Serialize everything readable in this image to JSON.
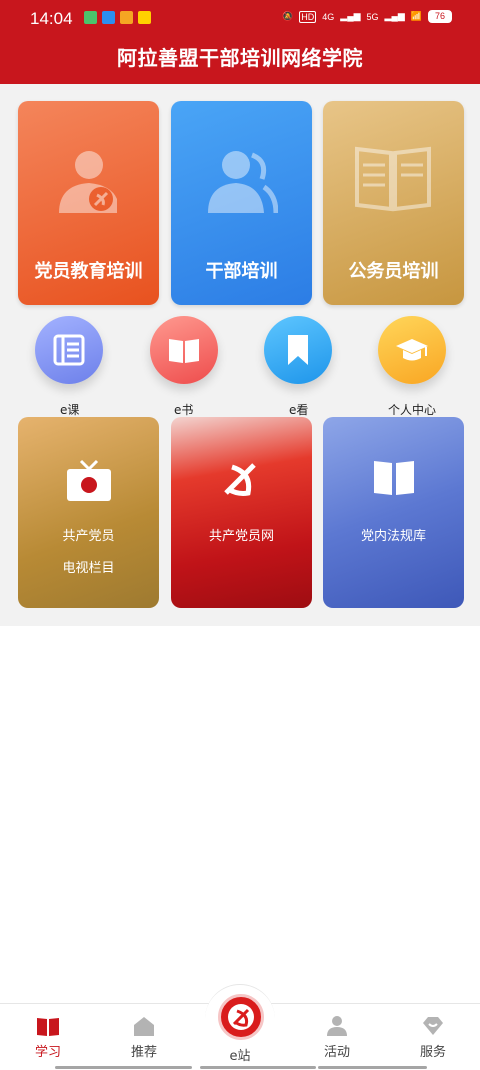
{
  "status_bar": {
    "time": "14:04",
    "battery": "76",
    "net1": "HD",
    "net2": "4G",
    "net3": "5G"
  },
  "header": {
    "title": "阿拉善盟干部培训网络学院"
  },
  "cards": [
    {
      "label": "党员教育培训",
      "icon": "party-member-icon"
    },
    {
      "label": "干部培训",
      "icon": "cadre-icon"
    },
    {
      "label": "公务员培训",
      "icon": "book-icon"
    }
  ],
  "quick_links": [
    {
      "label": "e课",
      "icon": "list-icon"
    },
    {
      "label": "e书",
      "icon": "book-icon"
    },
    {
      "label": "e看",
      "icon": "bookmark-icon"
    },
    {
      "label": "个人中心",
      "icon": "graduation-cap-icon"
    }
  ],
  "tiles": [
    {
      "line1": "共产党员",
      "line2": "电视栏目",
      "icon": "tv-icon"
    },
    {
      "label": "共产党员网",
      "icon": "party-emblem-icon"
    },
    {
      "label": "党内法规库",
      "icon": "open-book-icon"
    }
  ],
  "tabbar": {
    "items": [
      {
        "label": "学习",
        "icon": "book-icon",
        "active": true
      },
      {
        "label": "推荐",
        "icon": "home-icon",
        "active": false
      },
      {
        "label": "e站",
        "icon": "party-emblem-icon",
        "active": false
      },
      {
        "label": "活动",
        "icon": "person-icon",
        "active": false
      },
      {
        "label": "服务",
        "icon": "heart-diamond-icon",
        "active": false
      }
    ]
  },
  "colors": {
    "brand_red": "#c8161d",
    "orange": "#e8521f",
    "blue": "#2c7de5",
    "gold": "#c7963f"
  }
}
